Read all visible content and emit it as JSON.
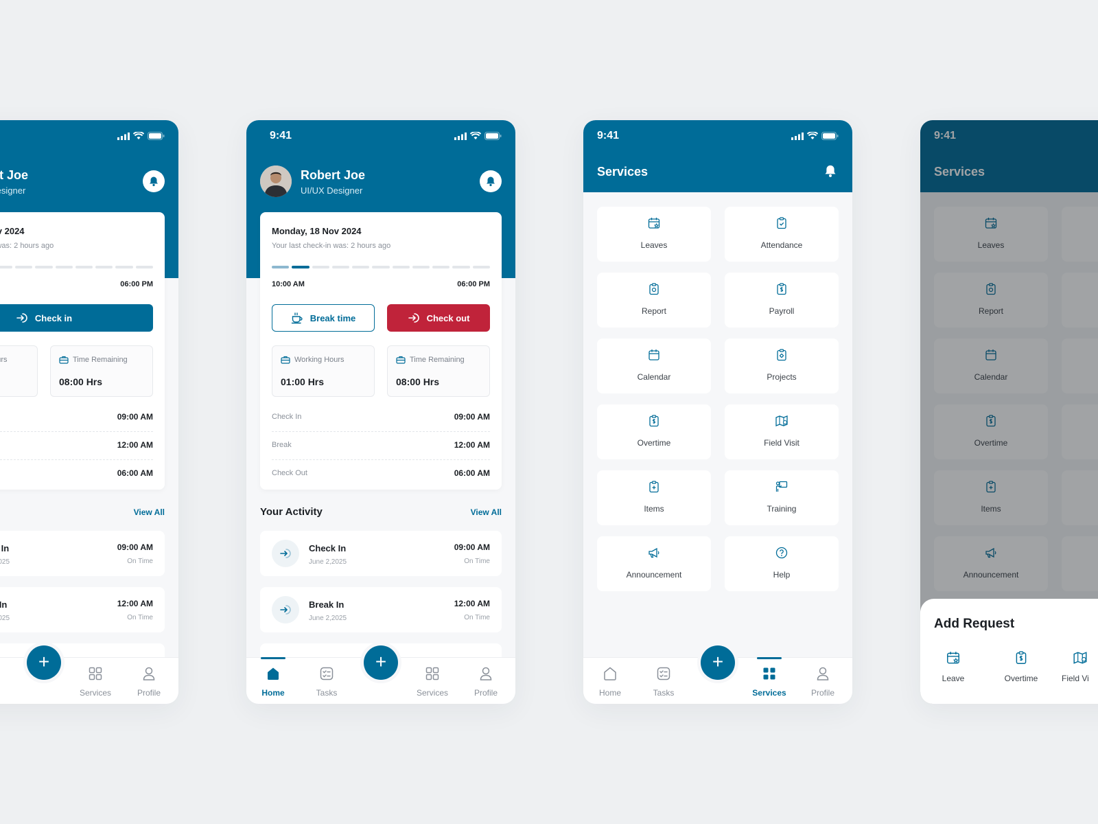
{
  "status": {
    "time": "9:41"
  },
  "home": {
    "user": {
      "name": "Robert Joe",
      "role": "UI/UX Designer"
    },
    "day": {
      "title": "Monday, 18 Nov 2024",
      "subtitle": "Your last check-in was: 2 hours ago",
      "start": "10:00 AM",
      "end": "06:00 PM",
      "progress_segments": 11,
      "progress_done": 2
    },
    "buttons": {
      "break": "Break time",
      "checkout": "Check out",
      "checkin": "Check in"
    },
    "stats": {
      "working": {
        "label": "Working Hours",
        "value": "01:00 Hrs"
      },
      "remaining": {
        "label": "Time Remaining",
        "value": "08:00 Hrs"
      }
    },
    "rows": [
      {
        "label": "Check In",
        "value": "09:00 AM"
      },
      {
        "label": "Break",
        "value": "12:00 AM"
      },
      {
        "label": "Check Out",
        "value": "06:00 AM"
      }
    ],
    "activity_title": "Your Activity",
    "view_all": "View All",
    "activity": [
      {
        "title": "Check In",
        "date": "June 2,2025",
        "time": "09:00 AM",
        "status": "On Time"
      },
      {
        "title": "Break In",
        "date": "June 2,2025",
        "time": "12:00 AM",
        "status": "On Time"
      }
    ]
  },
  "nav": {
    "home": "Home",
    "tasks": "Tasks",
    "services": "Services",
    "profile": "Profile",
    "fab": "+"
  },
  "services": {
    "title": "Services",
    "tiles": [
      "Leaves",
      "Attendance",
      "Report",
      "Payroll",
      "Calendar",
      "Projects",
      "Overtime",
      "Field Visit",
      "Items",
      "Training",
      "Announcement",
      "Help"
    ]
  },
  "sheet": {
    "title": "Add Request",
    "items": [
      "Leave",
      "Overtime",
      "Field Vi"
    ]
  },
  "colors": {
    "primary": "#006c98",
    "danger": "#c0233a",
    "bg": "#f6f7f9"
  }
}
